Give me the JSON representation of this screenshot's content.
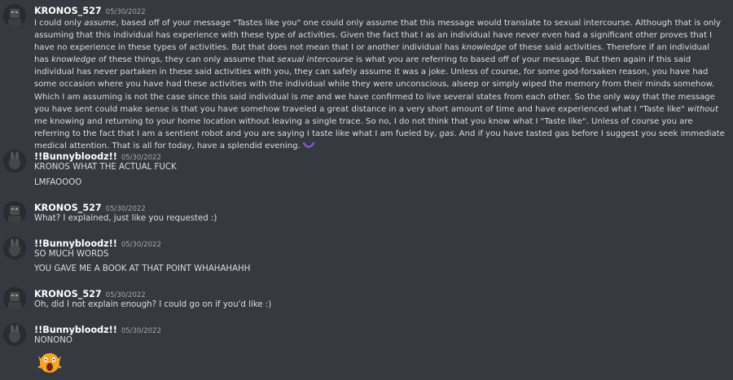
{
  "messages": [
    {
      "author": "KRONOS_527",
      "timestamp": "05/30/2022",
      "lines": [
        "I could only |assume|, based off of your message \"Tastes like you\" one could only assume that this message would translate to sexual intercourse. Although that is only assuming that this individual has experience with these type of activities. Given the fact that I as an individual have never even had a significant other proves that I have no experience in these types of activities. But that does not mean that I or another individual has |knowledge| of these said activities. Therefore if an individual has |knowledge| of these things, they can only assume that |sexual intercourse| is what you are referring to based off of your message. But then again if this said individual has never partaken in these said activities with you, they can safely assume it was a joke. Unless of course, for some god-forsaken reason, you have had some occasion where you have had these activities with the individual while they were unconscious, alseep or simply wiped the memory from their minds somehow. Which I am assuming is not the case since this said individual is |me| and we have confirmed to live several states from each other. So the only way that the message you have sent could make sense is that you have somehow traveled a great distance in a very short amount of time and have experienced what I \"Taste like\" |without| me knowing and returning to your home location without leaving a single trace. So no, I do not think that you know what I \"Taste like\". Unless of course you are referring to the fact that I am a sentient robot and you are saying I taste like what I am fueled by, |gas|. And if you have tasted gas before I suggest you seek immediate medical attention. That is all for today, have a splendid evening."
      ],
      "inline_emoji": "purple-smile-emoji"
    },
    {
      "author": "!!Bunnybloodz!!",
      "timestamp": "05/30/2022",
      "lines": [
        "KRONOS WHAT THE ACTUAL FUCK",
        "LMFAOOOO"
      ]
    },
    {
      "author": "KRONOS_527",
      "timestamp": "05/30/2022",
      "lines": [
        "What? I explained, just like you requested :)"
      ]
    },
    {
      "author": "!!Bunnybloodz!!",
      "timestamp": "05/30/2022",
      "lines": [
        "SO MUCH WORDS",
        "YOU GAVE ME A BOOK AT THAT POINT WHAHAHAHH"
      ]
    },
    {
      "author": "KRONOS_527",
      "timestamp": "05/30/2022",
      "lines": [
        "Oh, did I not explain enough? I could go on if you'd like :)"
      ]
    },
    {
      "author": "!!Bunnybloodz!!",
      "timestamp": "05/30/2022",
      "lines": [
        "NONONO"
      ],
      "big_emoji": "screaming-face-emoji"
    }
  ],
  "colors": {
    "background": "#36393f",
    "username": "#ffffff",
    "text": "#dcddde",
    "timestamp": "#a3a6aa"
  }
}
